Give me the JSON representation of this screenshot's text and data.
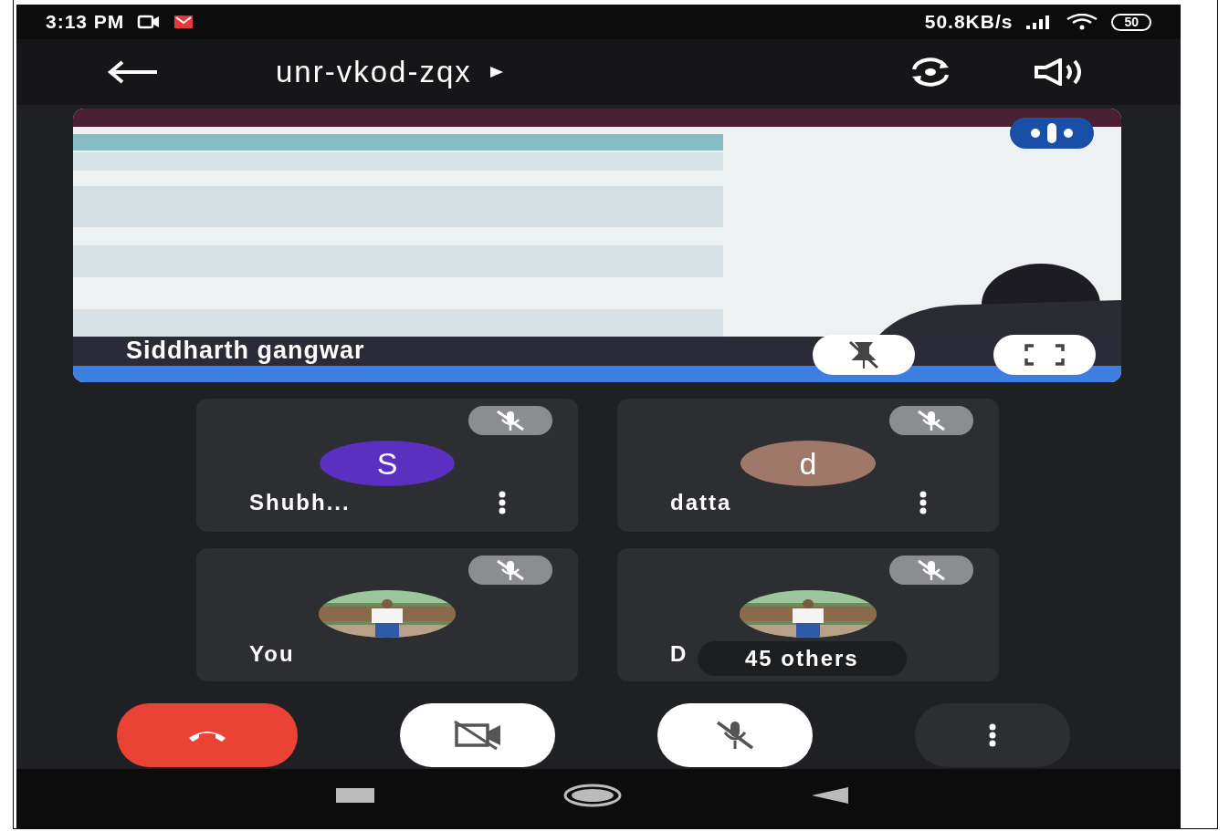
{
  "status_bar": {
    "time": "3:13 PM",
    "net_speed": "50.8KB/s",
    "battery": "50"
  },
  "meeting": {
    "code": "unr-vkod-zqx"
  },
  "presenter": {
    "name": "Siddharth gangwar",
    "speaking": true
  },
  "participants": [
    {
      "name": "Shubh...",
      "kind": "initial",
      "initial": "S",
      "color": "#5b2fc0",
      "muted": true,
      "menu": true
    },
    {
      "name": "datta",
      "kind": "initial",
      "initial": "d",
      "color": "#a0786a",
      "muted": true,
      "menu": true
    },
    {
      "name": "You",
      "muted": true,
      "menu": false
    },
    {
      "name": "D",
      "muted": true,
      "menu": false,
      "overlay": "45 others"
    }
  ],
  "controls": {
    "camera_on": false,
    "mic_on": false
  }
}
